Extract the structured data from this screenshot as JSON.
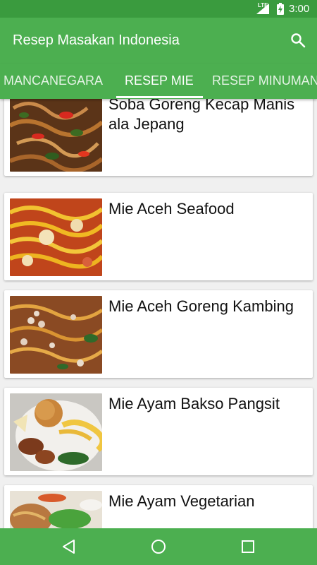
{
  "status": {
    "network": "LTE",
    "time": "3:00"
  },
  "app": {
    "title": "Resep Masakan Indonesia"
  },
  "tabs": [
    {
      "label": "MANCANEGARA",
      "selected": false
    },
    {
      "label": "RESEP MIE",
      "selected": true
    },
    {
      "label": "RESEP MINUMAN",
      "selected": false
    }
  ],
  "recipes": [
    {
      "title": "Soba Goreng Kecap Manis ala Jepang"
    },
    {
      "title": "Mie Aceh Seafood"
    },
    {
      "title": "Mie Aceh Goreng Kambing"
    },
    {
      "title": "Mie Ayam Bakso Pangsit"
    },
    {
      "title": "Mie Ayam Vegetarian"
    }
  ],
  "colors": {
    "primary": "#4caf50",
    "status_bar": "#3a9b3e",
    "card_bg": "#ffffff",
    "text": "#111111"
  },
  "icons": {
    "search": "search-icon",
    "back": "back-icon",
    "home": "home-icon",
    "recents": "recents-icon"
  }
}
